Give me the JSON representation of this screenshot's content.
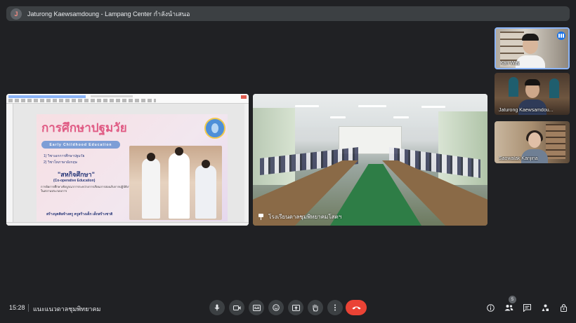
{
  "banner": {
    "avatar_letter": "J",
    "text": "Jaturong Kaewsamdoung - Lampang Center กำลังนำเสนอ"
  },
  "presentation": {
    "slide": {
      "title": "การศึกษาปฐมวัย",
      "subtitle": "Early Childhood Education",
      "item1": "1) วิชาเอกการศึกษาปฐมวัย",
      "item2": "2) วิชาโทภาษาอังกฤษ",
      "coop_th": "\"สหกิจศึกษา\"",
      "coop_en": "(Co-operative Education)",
      "body": "การจัดการศึกษาเชิงบูรณาการระหว่างการเรียนการสอนกับการปฏิบัติงานจริงในสถานประกอบการ",
      "footer": "สร้างบุคคิลจ้างครู ครูสร้างเด็ก เด็กสร้างชาติ"
    }
  },
  "classroom": {
    "label": "โรงเรียนดาลชุมพิทยาคมโสตฯ"
  },
  "participants": [
    {
      "name": "Kan Way"
    },
    {
      "name": "Jaturong Kaewsamdou..."
    },
    {
      "name": "Saowalak Kanjina"
    }
  ],
  "bottom_bar": {
    "time": "15:28",
    "meeting_name": "แนะแนวดาลชุมพิทยาคม",
    "controls": [
      {
        "icon": "mic-icon"
      },
      {
        "icon": "camera-icon"
      },
      {
        "icon": "captions-icon"
      },
      {
        "icon": "emoji-icon"
      },
      {
        "icon": "present-icon"
      },
      {
        "icon": "raise-hand-icon"
      },
      {
        "icon": "more-options-icon"
      },
      {
        "icon": "end-call-icon"
      }
    ],
    "right_icons": [
      {
        "icon": "info-icon"
      },
      {
        "icon": "people-icon"
      },
      {
        "icon": "chat-icon"
      },
      {
        "icon": "activities-icon"
      },
      {
        "icon": "host-controls-icon"
      }
    ],
    "participant_count": "5"
  },
  "colors": {
    "background": "#202124",
    "surface": "#3c4043",
    "end_call": "#ea4335",
    "active_speaker": "#8ab4f8"
  }
}
